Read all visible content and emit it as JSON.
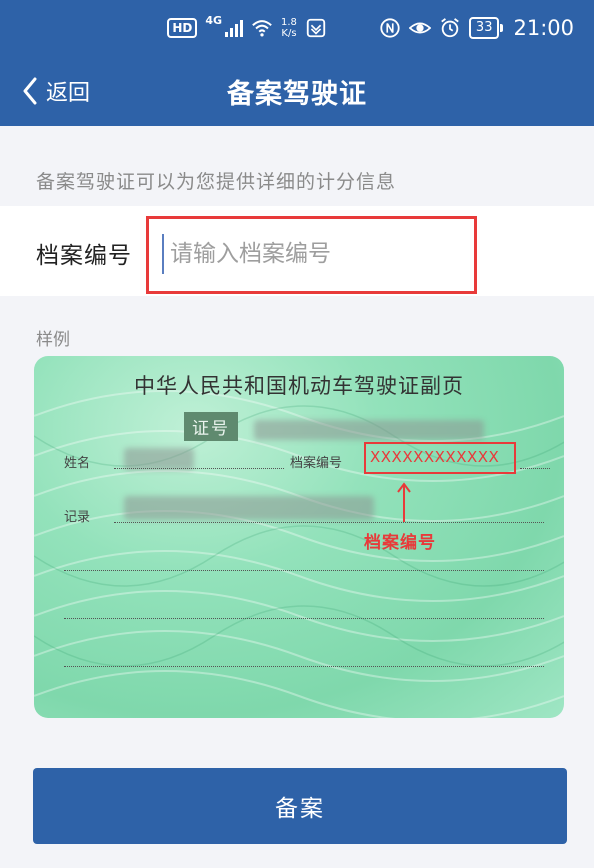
{
  "status_bar": {
    "hd_badge": "HD",
    "network": "4G",
    "speed_value": "1.8",
    "speed_unit": "K/s",
    "battery": "33",
    "time": "21:00",
    "icons": [
      "signal-icon",
      "wifi-icon",
      "app-notification-icon",
      "nfc-icon",
      "eye-icon",
      "alarm-icon",
      "battery-icon"
    ]
  },
  "navbar": {
    "back_label": "返回",
    "title": "备案驾驶证",
    "background_color": "#2e62a8"
  },
  "hint": "备案驾驶证可以为您提供详细的计分信息",
  "form": {
    "field_label": "档案编号",
    "input_value": "",
    "input_placeholder": "请输入档案编号",
    "highlight_color": "#e83a3a"
  },
  "sample": {
    "label": "样例",
    "card_title": "中华人民共和国机动车驾驶证副页",
    "cert_no_label": "证号",
    "name_label": "姓名",
    "archive_label": "档案编号",
    "archive_value": "XXXXXXXXXXXX",
    "record_label": "记录",
    "annotation": "档案编号"
  },
  "submit_label": "备案"
}
